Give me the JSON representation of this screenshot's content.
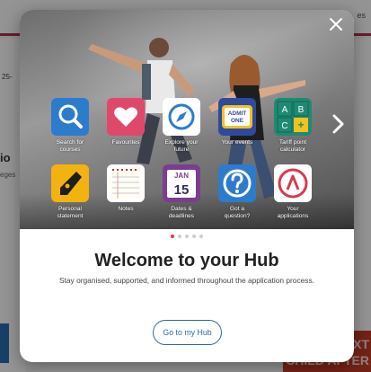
{
  "background": {
    "top_right_text": "es",
    "left_number": "25-",
    "left_big_text": "io",
    "left_small_text": "eges",
    "banner_line1": "EXT",
    "banner_line2": "CHILD AFTER"
  },
  "modal": {
    "close_icon": "close-icon",
    "next_icon": "chevron-right-icon",
    "tiles_row1": [
      {
        "label": "Search for\ncourses",
        "icon": "search-icon",
        "color": "#2d7ccc"
      },
      {
        "label": "Favourites",
        "icon": "heart-icon",
        "color": "#e0486a"
      },
      {
        "label": "Explore your\nfuture",
        "icon": "compass-icon",
        "color": "#ffffff"
      },
      {
        "label": "Your events",
        "icon": "ticket-icon",
        "color": "#2e4a9e"
      },
      {
        "label": "Tariff point\ncalculator",
        "icon": "calculator-icon",
        "color": "#1f8a73"
      }
    ],
    "tiles_row2": [
      {
        "label": "Personal\nstatement",
        "icon": "pen-nib-icon",
        "color": "#f2b310"
      },
      {
        "label": "Notes",
        "icon": "notepad-icon",
        "color": "#ffffff"
      },
      {
        "label": "Dates &\ndeadlines",
        "icon": "calendar-icon",
        "color": "#7b3e8e"
      },
      {
        "label": "Got a\nquestion?",
        "icon": "question-icon",
        "color": "#2d7ccc"
      },
      {
        "label": "Your\napplications",
        "icon": "ucas-logo-icon",
        "color": "#ffffff"
      }
    ],
    "ticket_text_1": "ADMIT",
    "ticket_text_2": "ONE",
    "calc_letters": [
      "A",
      "B",
      "C",
      "+"
    ],
    "calendar_month": "JAN",
    "calendar_day": "15",
    "carousel": {
      "total": 5,
      "active_index": 0
    },
    "title": "Welcome to your Hub",
    "subtitle": "Stay organised, supported, and informed throughout the application process.",
    "cta_label": "Go to my Hub"
  }
}
